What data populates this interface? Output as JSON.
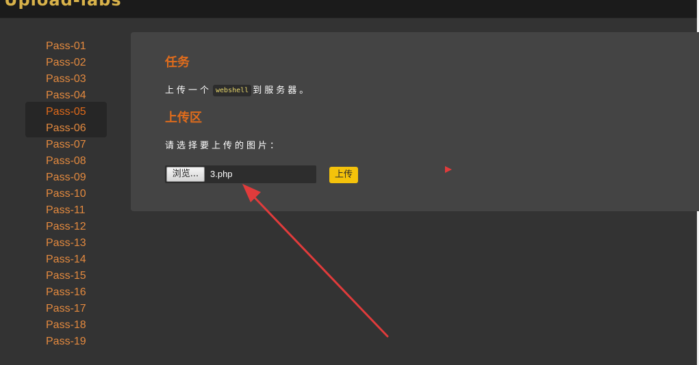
{
  "header": {
    "logo_text": "Upload-labs"
  },
  "sidebar": {
    "items": [
      {
        "label": "Pass-01"
      },
      {
        "label": "Pass-02"
      },
      {
        "label": "Pass-03"
      },
      {
        "label": "Pass-04"
      },
      {
        "label": "Pass-05"
      },
      {
        "label": "Pass-06"
      },
      {
        "label": "Pass-07"
      },
      {
        "label": "Pass-08"
      },
      {
        "label": "Pass-09"
      },
      {
        "label": "Pass-10"
      },
      {
        "label": "Pass-11"
      },
      {
        "label": "Pass-12"
      },
      {
        "label": "Pass-13"
      },
      {
        "label": "Pass-14"
      },
      {
        "label": "Pass-15"
      },
      {
        "label": "Pass-16"
      },
      {
        "label": "Pass-17"
      },
      {
        "label": "Pass-18"
      },
      {
        "label": "Pass-19"
      }
    ],
    "active_label": "Pass-05"
  },
  "task": {
    "title": "任务",
    "text_before": "上传一个",
    "code": "webshell",
    "text_after": "到服务器。"
  },
  "upload": {
    "title": "上传区",
    "prompt": "请选择要上传的图片：",
    "browse_label": "浏览...",
    "file_name": "3.php",
    "submit_label": "上传"
  },
  "colors": {
    "background": "#333333",
    "panel": "#444444",
    "accent": "#e06c1c",
    "link": "#e48a3f",
    "button": "#f4c20b",
    "annotation_arrow": "#e13b3b"
  },
  "icons": {
    "annotation": "red-arrow-icon",
    "marker": "red-triangle-icon"
  }
}
